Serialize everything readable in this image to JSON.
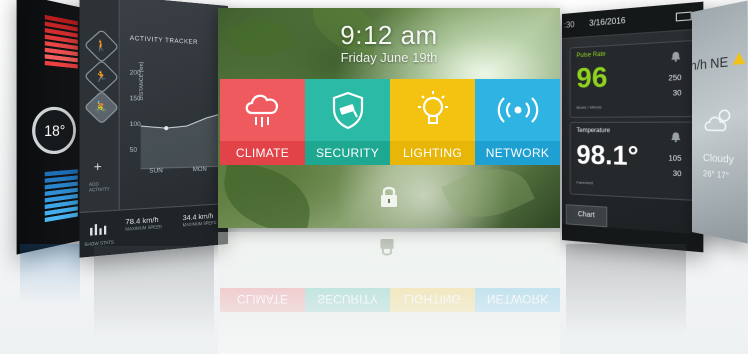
{
  "main": {
    "time": "9:12 am",
    "date": "Friday June 19th",
    "tiles": [
      {
        "label": "CLIMATE",
        "color": "#ef5a5f",
        "band": "#e24348",
        "icon": "cloud-rain-icon"
      },
      {
        "label": "SECURITY",
        "color": "#2bbaa5",
        "band": "#1ea891",
        "icon": "security-camera-shield-icon"
      },
      {
        "label": "LIGHTING",
        "color": "#f4c311",
        "band": "#e8b608",
        "icon": "lightbulb-icon"
      },
      {
        "label": "NETWORK",
        "color": "#2fb3e3",
        "band": "#1ea0d2",
        "icon": "wireless-signal-icon"
      }
    ],
    "lock_icon": "lock-icon"
  },
  "far_left": {
    "temperature": "18°"
  },
  "activity": {
    "title": "ACTIVITY TRACKER",
    "y_ticks": [
      "200",
      "150",
      "100",
      "50"
    ],
    "y_label": "DISTANCE (km)",
    "x_ticks": [
      "SUN",
      "MON"
    ],
    "add_label": "ADD ACTIVITY",
    "speed1_value": "78.4 km/h",
    "speed1_label": "MAXIMUM SPEED",
    "speed2_value": "34.4 km/h",
    "speed2_label": "MAXIMUM SPEED",
    "show_stats_label": "SHOW STATS"
  },
  "vitals": {
    "time_fragment": ":30",
    "date": "3/16/2016",
    "pulse": {
      "title": "Pulse Rate",
      "value": "96",
      "unit": "Beats / Minute",
      "high": "250",
      "low": "30",
      "value_color": "#8ed11e"
    },
    "temperature": {
      "title": "Temperature",
      "value": "98.1°",
      "unit": "Farenheit",
      "high": "105",
      "low": "30"
    },
    "chart_button": "Chart"
  },
  "weather": {
    "wind": "n/h NE",
    "condition": "Cloudy",
    "temps": "26° 17°"
  }
}
